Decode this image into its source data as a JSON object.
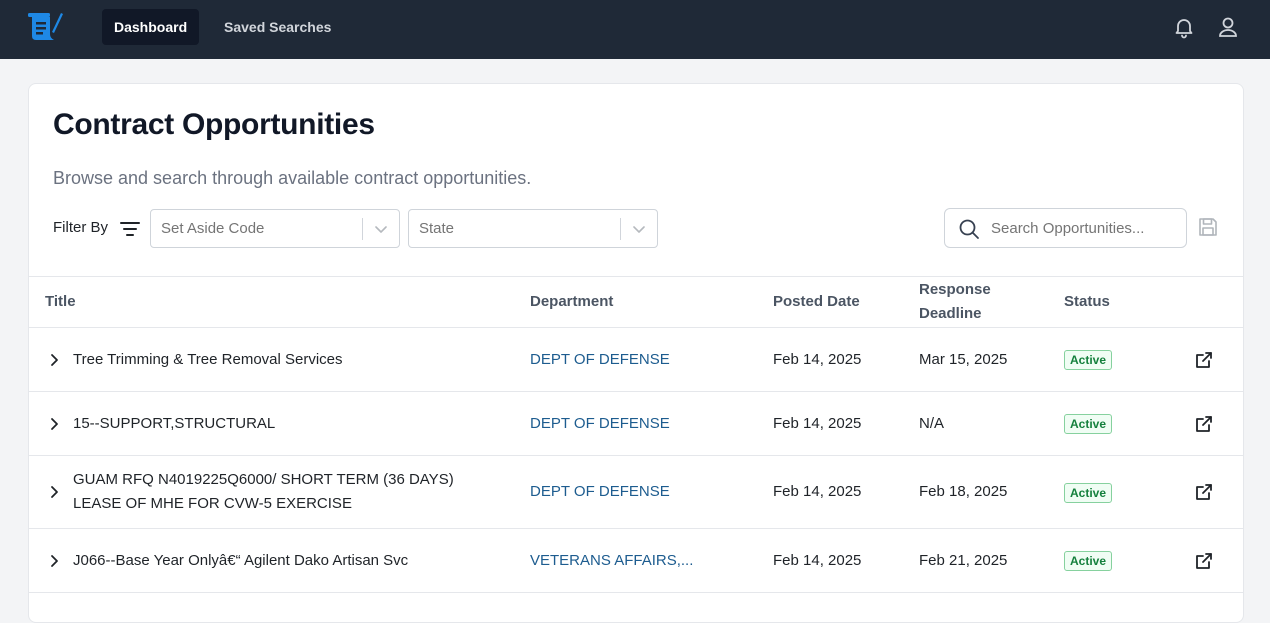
{
  "nav": {
    "items": [
      {
        "label": "Dashboard",
        "active": true
      },
      {
        "label": "Saved Searches",
        "active": false
      }
    ],
    "icons": [
      "bell-icon",
      "user-icon"
    ]
  },
  "page": {
    "title": "Contract Opportunities",
    "subtitle": "Browse and search through available contract opportunities."
  },
  "filters": {
    "label": "Filter By",
    "set_aside_placeholder": "Set Aside Code",
    "state_placeholder": "State"
  },
  "search": {
    "placeholder": "Search Opportunities...",
    "value": ""
  },
  "table": {
    "headers": {
      "title": "Title",
      "department": "Department",
      "posted": "Posted Date",
      "deadline_line1": "Response",
      "deadline_line2": "Deadline",
      "status": "Status"
    },
    "rows": [
      {
        "title_line1": "Tree Trimming & Tree Removal Services",
        "title_line2": "",
        "department": "DEPT OF DEFENSE",
        "posted": "Feb 14, 2025",
        "deadline": "Mar 15, 2025",
        "status": "Active"
      },
      {
        "title_line1": "15--SUPPORT,STRUCTURAL",
        "title_line2": "",
        "department": "DEPT OF DEFENSE",
        "posted": "Feb 14, 2025",
        "deadline": "N/A",
        "status": "Active"
      },
      {
        "title_line1": "GUAM RFQ N4019225Q6000/ SHORT TERM (36 DAYS)",
        "title_line2": "LEASE OF MHE FOR CVW-5 EXERCISE",
        "department": "DEPT OF DEFENSE",
        "posted": "Feb 14, 2025",
        "deadline": "Feb 18, 2025",
        "status": "Active"
      },
      {
        "title_line1": "J066--Base Year Onlyâ€“ Agilent Dako Artisan Svc",
        "title_line2": "",
        "department": "VETERANS AFFAIRS,...",
        "posted": "Feb 14, 2025",
        "deadline": "Feb 21, 2025",
        "status": "Active"
      }
    ]
  },
  "colors": {
    "topbar": "#1f2937",
    "link": "#1d5c8f",
    "status_active": "#15803d",
    "logo": "#1e88e5"
  }
}
